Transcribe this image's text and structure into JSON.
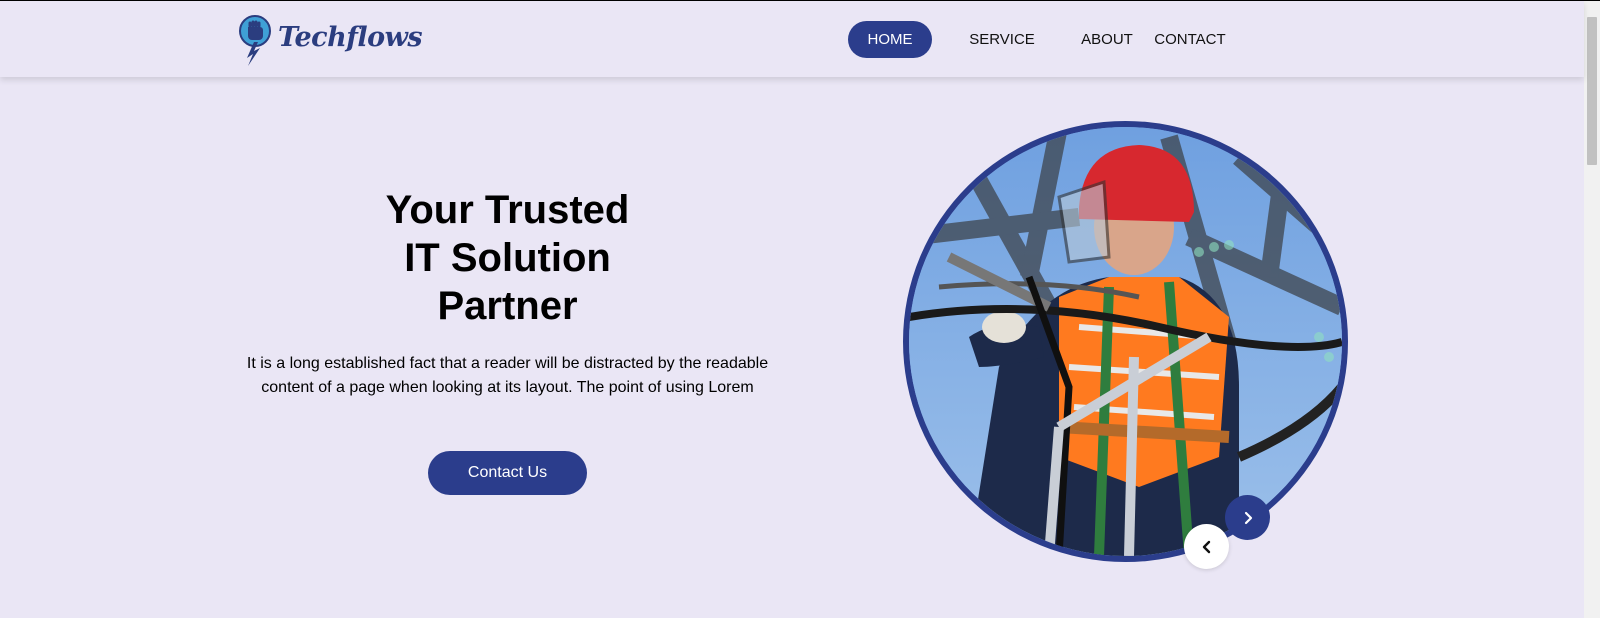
{
  "header": {
    "brand": "Techflows",
    "nav": [
      {
        "label": "HOME",
        "active": true
      },
      {
        "label": "SERVICE",
        "active": false
      },
      {
        "label": "ABOUT",
        "active": false
      },
      {
        "label": "CONTACT",
        "active": false
      }
    ]
  },
  "hero": {
    "title_lines": [
      "Your Trusted",
      "IT Solution",
      "Partner"
    ],
    "text_lines": [
      "It is a long established fact that a reader will be distracted by the readable",
      "content of a page when looking at its layout. The point of using Lorem"
    ],
    "cta_label": "Contact Us"
  },
  "carousel": {
    "image_icon": "electrician-worker-photo",
    "prev_icon": "chevron-left-icon",
    "next_icon": "chevron-right-icon"
  },
  "colors": {
    "brand": "#2b3d8c",
    "background": "#eae6f5",
    "logo_text": "#2b3d7f"
  }
}
